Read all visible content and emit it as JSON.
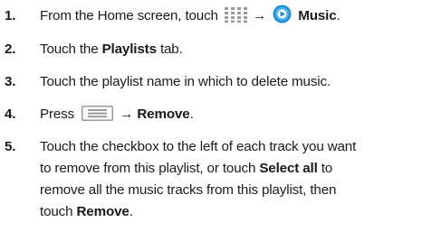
{
  "steps": [
    {
      "num": "1.",
      "text_a": "From the Home screen, touch",
      "arrow": "→",
      "bold": "Music",
      "text_b": ".",
      "icons": [
        "apps-grid-icon",
        "music-app-icon"
      ]
    },
    {
      "num": "2.",
      "text_a": "Touch the ",
      "bold": "Playlists",
      "text_b": " tab."
    },
    {
      "num": "3.",
      "text_a": "Touch the playlist name in which to delete music."
    },
    {
      "num": "4.",
      "text_a": "Press",
      "arrow": "→",
      "bold": "Remove",
      "text_b": ".",
      "icons": [
        "menu-key-icon"
      ]
    },
    {
      "num": "5.",
      "line1": "Touch the checkbox to the left of each track you want",
      "line2_a": "to remove from this playlist, or touch ",
      "line2_bold": "Select all",
      "line2_b": " to",
      "line3": "remove all the music tracks from this playlist, then",
      "line4_a": "touch ",
      "line4_bold": "Remove",
      "line4_b": "."
    }
  ],
  "colors": {
    "text": "#1a1a1a",
    "icon_grey": "#9a9a9a",
    "music_blue": "#1f8fd8"
  }
}
